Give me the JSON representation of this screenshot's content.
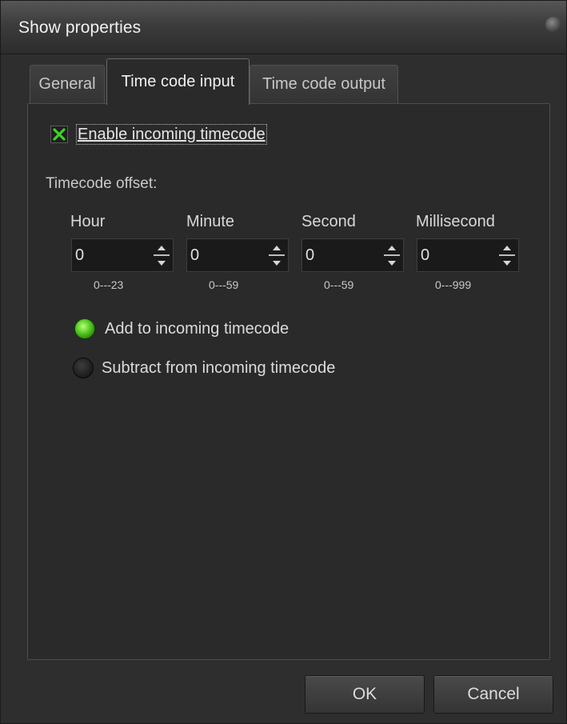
{
  "window": {
    "title": "Show properties"
  },
  "tabs": [
    {
      "label": "General"
    },
    {
      "label": "Time code input"
    },
    {
      "label": "Time code output"
    }
  ],
  "enable": {
    "label": "Enable incoming timecode",
    "checked": true
  },
  "offset_label": "Timecode offset:",
  "fields": [
    {
      "label": "Hour",
      "value": "0",
      "range": "0---23"
    },
    {
      "label": "Minute",
      "value": "0",
      "range": "0---59"
    },
    {
      "label": "Second",
      "value": "0",
      "range": "0---59"
    },
    {
      "label": "Millisecond",
      "value": "0",
      "range": "0---999"
    }
  ],
  "radios": [
    {
      "label": "Add to incoming timecode",
      "selected": true
    },
    {
      "label": "Subtract from incoming timecode",
      "selected": false
    }
  ],
  "buttons": {
    "ok": "OK",
    "cancel": "Cancel"
  },
  "colors": {
    "accent_green": "#4fc81f",
    "window_bg": "#2e2e2e"
  }
}
